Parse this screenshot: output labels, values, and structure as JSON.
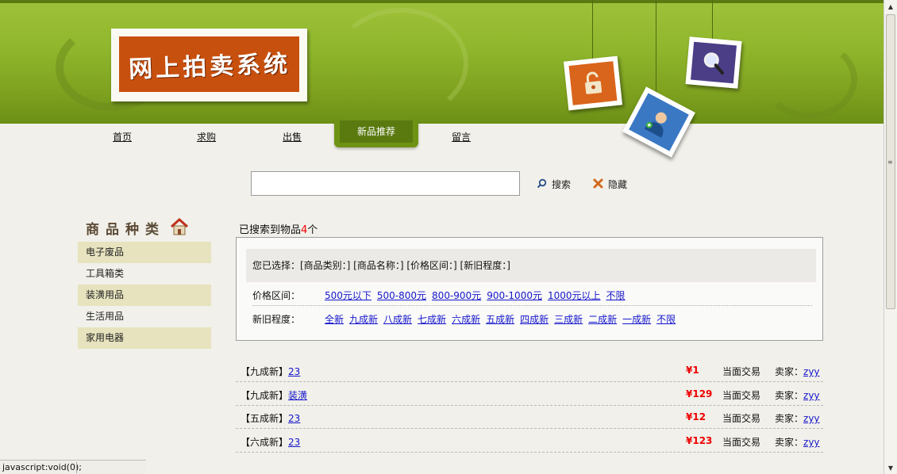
{
  "header": {
    "logo_text": "网上拍卖系统"
  },
  "nav": {
    "items": [
      {
        "label": "首页"
      },
      {
        "label": "求购"
      },
      {
        "label": "出售"
      },
      {
        "label": "新品推荐"
      },
      {
        "label": "留言"
      }
    ],
    "active_index": 3
  },
  "search": {
    "input_value": "",
    "search_label": "搜索",
    "hide_label": "隐藏"
  },
  "sidebar": {
    "title": "商品种类",
    "categories": [
      {
        "label": "电子废品"
      },
      {
        "label": "工具箱类"
      },
      {
        "label": "装潢用品"
      },
      {
        "label": "生活用品"
      },
      {
        "label": "家用电器"
      }
    ]
  },
  "results": {
    "found_prefix": "已搜索到物品",
    "found_count": "4",
    "found_suffix": "个",
    "selected_text": "您已选择：[商品类别：] [商品名称：] [价格区间：] [新旧程度：]",
    "price_label": "价格区间：",
    "price_options": [
      "500元以下",
      "500-800元",
      "800-900元",
      "900-1000元",
      "1000元以上",
      "不限"
    ],
    "condition_label": "新旧程度：",
    "condition_options": [
      "全新",
      "九成新",
      "八成新",
      "七成新",
      "六成新",
      "五成新",
      "四成新",
      "三成新",
      "二成新",
      "一成新",
      "不限"
    ],
    "items": [
      {
        "condition": "【九成新】",
        "name": "23",
        "price": "¥1",
        "trade": "当面交易",
        "seller_label": "卖家：",
        "seller": "zyy"
      },
      {
        "condition": "【九成新】",
        "name": "装潢",
        "price": "¥129",
        "trade": "当面交易",
        "seller_label": "卖家：",
        "seller": "zyy"
      },
      {
        "condition": "【五成新】",
        "name": "23",
        "price": "¥12",
        "trade": "当面交易",
        "seller_label": "卖家：",
        "seller": "zyy"
      },
      {
        "condition": "【六成新】",
        "name": "23",
        "price": "¥123",
        "trade": "当面交易",
        "seller_label": "卖家：",
        "seller": "zyy"
      }
    ]
  },
  "statusbar": {
    "text": "javascript:void(0);"
  },
  "colors": {
    "header_green": "#8fb62c",
    "nav_active": "#5a7a10",
    "logo_orange": "#c8500e",
    "price_red": "#ee0000",
    "link_blue": "#1515cc",
    "category_bg": "#e6e3be"
  },
  "icons": {
    "search": "magnifier-icon",
    "hide": "x-icon",
    "home": "house-icon",
    "lock": "lock-icon",
    "user": "user-icon",
    "photo_search": "magnifier-icon"
  }
}
